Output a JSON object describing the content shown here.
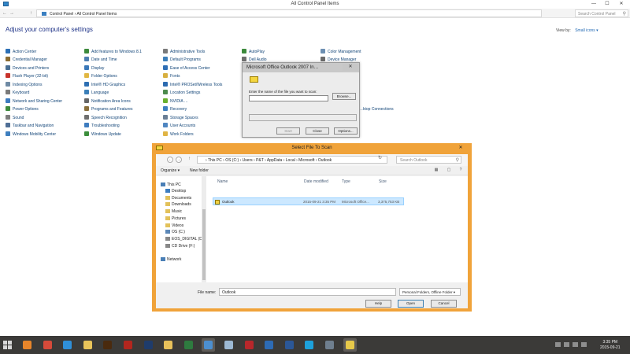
{
  "control_panel": {
    "window_title": "All Control Panel Items",
    "minimize": "—",
    "maximize": "☐",
    "close": "✕",
    "address": "Control Panel  ›  All Control Panel Items",
    "search_placeholder": "Search Control Panel",
    "heading": "Adjust your computer's settings",
    "view_by_label": "View by:",
    "view_by_value": "Small icons ▾",
    "items": [
      {
        "label": "Action Center",
        "color": "#2c6fb5"
      },
      {
        "label": "Credential Manager",
        "color": "#8c6b2f"
      },
      {
        "label": "Devices and Printers",
        "color": "#4a6f93"
      },
      {
        "label": "Flash Player (32-bit)",
        "color": "#c8332b"
      },
      {
        "label": "Indexing Options",
        "color": "#6f8aa4"
      },
      {
        "label": "Keyboard",
        "color": "#7a7a7a"
      },
      {
        "label": "Network and Sharing Center",
        "color": "#3d7bc0"
      },
      {
        "label": "Power Options",
        "color": "#3d8a3d"
      },
      {
        "label": "Sound",
        "color": "#7f7f7f"
      },
      {
        "label": "Taskbar and Navigation",
        "color": "#4f6f96"
      },
      {
        "label": "Windows Mobility Center",
        "color": "#3f7fbf"
      },
      {
        "label": "Add features to Windows 8.1",
        "color": "#3c8a3c"
      },
      {
        "label": "Date and Time",
        "color": "#4d7db0"
      },
      {
        "label": "Display",
        "color": "#3a78b8"
      },
      {
        "label": "Folder Options",
        "color": "#e1b743"
      },
      {
        "label": "Intel® HD Graphics",
        "color": "#2d6fb3"
      },
      {
        "label": "Language",
        "color": "#3b7fb8"
      },
      {
        "label": "Notification Area Icons",
        "color": "#666666"
      },
      {
        "label": "Programs and Features",
        "color": "#8a6f3b"
      },
      {
        "label": "Speech Recognition",
        "color": "#6f6f6f"
      },
      {
        "label": "Troubleshooting",
        "color": "#3e7cbf"
      },
      {
        "label": "Windows Update",
        "color": "#3b8e3b"
      },
      {
        "label": "Administrative Tools",
        "color": "#7a7a7a"
      },
      {
        "label": "Default Programs",
        "color": "#3d7fb9"
      },
      {
        "label": "Ease of Access Center",
        "color": "#2f6fb5"
      },
      {
        "label": "Fonts",
        "color": "#d8b040"
      },
      {
        "label": "Intel® PROSet/Wireless Tools",
        "color": "#2c6bb0"
      },
      {
        "label": "Location Settings",
        "color": "#4c8a4c"
      },
      {
        "label": "NVIDIA …",
        "color": "#6ab02e"
      },
      {
        "label": "Recovery",
        "color": "#3f7fbf"
      },
      {
        "label": "Storage Spaces",
        "color": "#6a7f96"
      },
      {
        "label": "User Accounts",
        "color": "#4f86c1"
      },
      {
        "label": "Work Folders",
        "color": "#e0b444"
      },
      {
        "label": "AutoPlay",
        "color": "#3c8a3c"
      },
      {
        "label": "Dell Audio",
        "color": "#6f6f6f"
      },
      {
        "label": "Color Management",
        "color": "#6c8fb2"
      },
      {
        "label": "Device Manager",
        "color": "#6a6a6a"
      },
      {
        "label": "…ktop Connections",
        "color": "#3d7dbd"
      }
    ]
  },
  "scan_dialog": {
    "title": "Microsoft Office Outlook 2007 In…",
    "close": "✕",
    "prompt": "Enter the name of the file you want to scan:",
    "file_value": "",
    "browse": "Browse...",
    "start": "Start",
    "close_button": "Close",
    "options": "Options..."
  },
  "file_dialog": {
    "title": "Select File To Scan",
    "close": "✕",
    "address": "›  This PC  ›  OS (C:)  ›  Users  ›  P&T  ›  AppData  ›  Local  ›  Microsoft  ›  Outlook",
    "search_placeholder": "Search Outlook",
    "organize": "Organize ▾",
    "new_folder": "New folder",
    "tree": [
      {
        "label": "This PC",
        "color": "#4a7fb6"
      },
      {
        "label": "Desktop",
        "color": "#3d7dbf"
      },
      {
        "label": "Documents",
        "color": "#e2c15a"
      },
      {
        "label": "Downloads",
        "color": "#e2c15a"
      },
      {
        "label": "Music",
        "color": "#e2c15a"
      },
      {
        "label": "Pictures",
        "color": "#e2c15a"
      },
      {
        "label": "Videos",
        "color": "#e2c15a"
      },
      {
        "label": "OS (C:)",
        "color": "#5b87b7"
      },
      {
        "label": "EOS_DIGITAL (D:",
        "color": "#888888"
      },
      {
        "label": "CD Drive (F:)",
        "color": "#888888"
      },
      {
        "label": "Network",
        "color": "#4a7fb6"
      }
    ],
    "columns": {
      "name": "Name",
      "date": "Date modified",
      "type": "Type",
      "size": "Size"
    },
    "rows": [
      {
        "name": "Outlook",
        "date": "2015-09-21 3:35 PM",
        "type": "Microsoft Office...",
        "size": "3,375,753 KB"
      }
    ],
    "file_name_label": "File name:",
    "file_name_value": "Outlook",
    "filter": "Personal Folders, Offline Folder ▾",
    "help": "Help",
    "open": "Open",
    "cancel": "Cancel"
  },
  "taskbar": {
    "apps": [
      {
        "name": "firefox",
        "color": "#e8852a"
      },
      {
        "name": "chrome",
        "color": "#d64a3a"
      },
      {
        "name": "internet-explorer",
        "color": "#2f8fd8"
      },
      {
        "name": "file-explorer",
        "color": "#e9c45a"
      },
      {
        "name": "illustrator",
        "color": "#4a2a0e"
      },
      {
        "name": "adobe-reader",
        "color": "#b3261e"
      },
      {
        "name": "photoshop",
        "color": "#1f3c6b"
      },
      {
        "name": "folder",
        "color": "#e8c15a"
      },
      {
        "name": "excel",
        "color": "#2e7b3f"
      },
      {
        "name": "control-panel",
        "color": "#4c8fd0"
      },
      {
        "name": "notepad",
        "color": "#9db9d4"
      },
      {
        "name": "filezilla",
        "color": "#b8272b"
      },
      {
        "name": "outlook",
        "color": "#2d6bb5"
      },
      {
        "name": "word",
        "color": "#2b5797"
      },
      {
        "name": "skype",
        "color": "#1da1dc"
      },
      {
        "name": "network",
        "color": "#6f7f8f"
      },
      {
        "name": "scanpst",
        "color": "#e7c94a"
      }
    ],
    "time": "3:35 PM",
    "date": "2015-09-21"
  }
}
